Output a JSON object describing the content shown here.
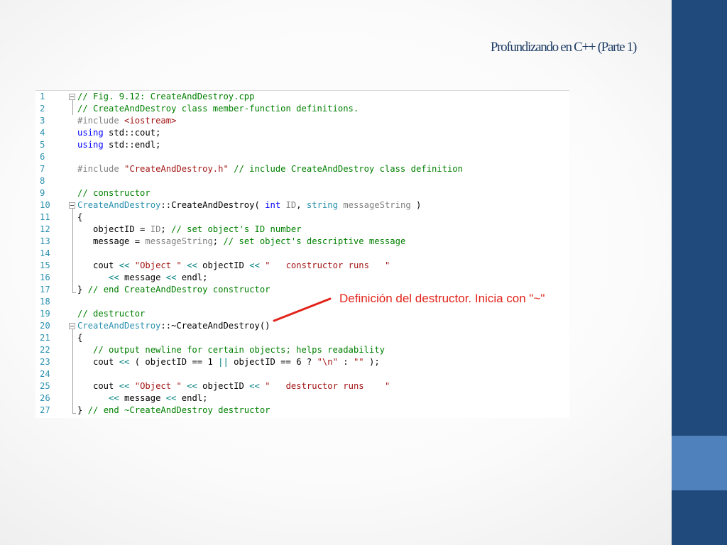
{
  "slide": {
    "title": "Profundizando en C++ (Parte 1)"
  },
  "annotation": {
    "text": "Definición del destructor. Inicia con \"~\""
  },
  "colors": {
    "sidebar": "#1f4a7b",
    "sidebar_accent": "#4f81bd",
    "title": "#1f3d66",
    "annotation": "#e2231a"
  },
  "code": {
    "lines": [
      {
        "n": "1",
        "tokens": [
          {
            "t": "// Fig. 9.12: CreateAndDestroy.cpp",
            "c": "com"
          }
        ]
      },
      {
        "n": "2",
        "tokens": [
          {
            "t": "// CreateAndDestroy class member-function definitions.",
            "c": "com"
          }
        ]
      },
      {
        "n": "3",
        "tokens": [
          {
            "t": "#include ",
            "c": "pp"
          },
          {
            "t": "<iostream>",
            "c": "str"
          }
        ]
      },
      {
        "n": "4",
        "tokens": [
          {
            "t": "using",
            "c": "kw"
          },
          {
            "t": " std::cout;",
            "c": ""
          }
        ]
      },
      {
        "n": "5",
        "tokens": [
          {
            "t": "using",
            "c": "kw"
          },
          {
            "t": " std::endl;",
            "c": ""
          }
        ]
      },
      {
        "n": "6",
        "tokens": []
      },
      {
        "n": "7",
        "tokens": [
          {
            "t": "#include ",
            "c": "pp"
          },
          {
            "t": "\"CreateAndDestroy.h\"",
            "c": "str"
          },
          {
            "t": " // include CreateAndDestroy class definition",
            "c": "com"
          }
        ]
      },
      {
        "n": "8",
        "tokens": []
      },
      {
        "n": "9",
        "tokens": [
          {
            "t": "// constructor",
            "c": "com"
          }
        ]
      },
      {
        "n": "10",
        "tokens": [
          {
            "t": "CreateAndDestroy",
            "c": "type"
          },
          {
            "t": "::CreateAndDestroy( ",
            "c": ""
          },
          {
            "t": "int",
            "c": "kw"
          },
          {
            "t": " ",
            "c": ""
          },
          {
            "t": "ID",
            "c": "param"
          },
          {
            "t": ", ",
            "c": ""
          },
          {
            "t": "string",
            "c": "type"
          },
          {
            "t": " ",
            "c": ""
          },
          {
            "t": "messageString",
            "c": "param"
          },
          {
            "t": " )",
            "c": ""
          }
        ]
      },
      {
        "n": "11",
        "tokens": [
          {
            "t": "{",
            "c": ""
          }
        ]
      },
      {
        "n": "12",
        "tokens": [
          {
            "t": "   objectID = ",
            "c": ""
          },
          {
            "t": "ID",
            "c": "param"
          },
          {
            "t": "; ",
            "c": ""
          },
          {
            "t": "// set object's ID number",
            "c": "com"
          }
        ]
      },
      {
        "n": "13",
        "tokens": [
          {
            "t": "   message = ",
            "c": ""
          },
          {
            "t": "messageString",
            "c": "param"
          },
          {
            "t": "; ",
            "c": ""
          },
          {
            "t": "// set object's descriptive message",
            "c": "com"
          }
        ]
      },
      {
        "n": "14",
        "tokens": []
      },
      {
        "n": "15",
        "tokens": [
          {
            "t": "   cout ",
            "c": ""
          },
          {
            "t": "<<",
            "c": "op"
          },
          {
            "t": " ",
            "c": ""
          },
          {
            "t": "\"Object \"",
            "c": "str"
          },
          {
            "t": " ",
            "c": ""
          },
          {
            "t": "<<",
            "c": "op"
          },
          {
            "t": " objectID ",
            "c": ""
          },
          {
            "t": "<<",
            "c": "op"
          },
          {
            "t": " ",
            "c": ""
          },
          {
            "t": "\"   constructor runs   \"",
            "c": "str"
          }
        ]
      },
      {
        "n": "16",
        "tokens": [
          {
            "t": "      ",
            "c": ""
          },
          {
            "t": "<<",
            "c": "op"
          },
          {
            "t": " message ",
            "c": ""
          },
          {
            "t": "<<",
            "c": "op"
          },
          {
            "t": " endl;",
            "c": ""
          }
        ]
      },
      {
        "n": "17",
        "tokens": [
          {
            "t": "} ",
            "c": ""
          },
          {
            "t": "// end CreateAndDestroy constructor",
            "c": "com"
          }
        ]
      },
      {
        "n": "18",
        "tokens": []
      },
      {
        "n": "19",
        "tokens": [
          {
            "t": "// destructor",
            "c": "com"
          }
        ]
      },
      {
        "n": "20",
        "tokens": [
          {
            "t": "CreateAndDestroy",
            "c": "type"
          },
          {
            "t": "::~CreateAndDestroy()",
            "c": ""
          }
        ]
      },
      {
        "n": "21",
        "tokens": [
          {
            "t": "{",
            "c": ""
          }
        ]
      },
      {
        "n": "22",
        "tokens": [
          {
            "t": "   // output newline for certain objects; helps readability",
            "c": "com"
          }
        ]
      },
      {
        "n": "23",
        "tokens": [
          {
            "t": "   cout ",
            "c": ""
          },
          {
            "t": "<<",
            "c": "op"
          },
          {
            "t": " ( objectID == 1 ",
            "c": ""
          },
          {
            "t": "||",
            "c": "op"
          },
          {
            "t": " objectID == 6 ? ",
            "c": ""
          },
          {
            "t": "\"\\n\"",
            "c": "str"
          },
          {
            "t": " : ",
            "c": ""
          },
          {
            "t": "\"\"",
            "c": "str"
          },
          {
            "t": " );",
            "c": ""
          }
        ]
      },
      {
        "n": "24",
        "tokens": []
      },
      {
        "n": "25",
        "tokens": [
          {
            "t": "   cout ",
            "c": ""
          },
          {
            "t": "<<",
            "c": "op"
          },
          {
            "t": " ",
            "c": ""
          },
          {
            "t": "\"Object \"",
            "c": "str"
          },
          {
            "t": " ",
            "c": ""
          },
          {
            "t": "<<",
            "c": "op"
          },
          {
            "t": " objectID ",
            "c": ""
          },
          {
            "t": "<<",
            "c": "op"
          },
          {
            "t": " ",
            "c": ""
          },
          {
            "t": "\"   destructor runs    \"",
            "c": "str"
          }
        ]
      },
      {
        "n": "26",
        "tokens": [
          {
            "t": "      ",
            "c": ""
          },
          {
            "t": "<<",
            "c": "op"
          },
          {
            "t": " message ",
            "c": ""
          },
          {
            "t": "<<",
            "c": "op"
          },
          {
            "t": " endl;",
            "c": ""
          }
        ]
      },
      {
        "n": "27",
        "tokens": [
          {
            "t": "} ",
            "c": ""
          },
          {
            "t": "// end ~CreateAndDestroy destructor",
            "c": "com"
          }
        ]
      }
    ]
  }
}
